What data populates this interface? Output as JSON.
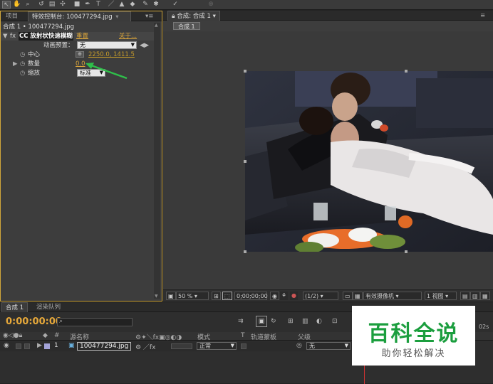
{
  "toolbar": {
    "search_icon_glyph": "⌕",
    "text_tool_glyph": "T"
  },
  "left_panel": {
    "tabs": [
      {
        "label": "项目"
      },
      {
        "label": "特效控制台: 100477294.jpg"
      }
    ],
    "breadcrumb": "合成 1 • 100477294.jpg",
    "effect": {
      "fx": "fx",
      "name": "CC 放射状快速模糊",
      "reset": "重置",
      "about": "关于..."
    },
    "preset": {
      "label": "动画预置：",
      "value": "无"
    },
    "params": [
      {
        "label": "中心",
        "value": "2250.0, 1411.5"
      },
      {
        "label": "数量",
        "value": "0.0"
      },
      {
        "label": "缩放",
        "value": "标准"
      }
    ]
  },
  "right_panel": {
    "tab": "合成: 合成 1",
    "sub_tab": "合成 1",
    "viewer_bar": {
      "zoom": "50 %",
      "timecode": "0;00;00;00",
      "resolution": "(1/2)",
      "camera": "有效摄像机",
      "views": "1 视图"
    }
  },
  "timeline": {
    "tabs": [
      {
        "label": "合成 1"
      },
      {
        "label": "渲染队列"
      }
    ],
    "timecode": "0:00:00:00",
    "search_placeholder": "",
    "headers": {
      "num": "#",
      "source": "源名称",
      "mode": "模式",
      "t": "T",
      "trkmat": "轨道蒙板",
      "parent": "父级"
    },
    "layer": {
      "num": "1",
      "name": "100477294.jpg",
      "mode": "正常",
      "parent": "无"
    },
    "ruler": "02s"
  },
  "watermark": {
    "title": "百科全说",
    "subtitle": "助你轻松解决"
  },
  "colors": {
    "accent": "#d9a43a",
    "arrow": "#2fbf4a",
    "watermark_green": "#1b9e3e"
  }
}
